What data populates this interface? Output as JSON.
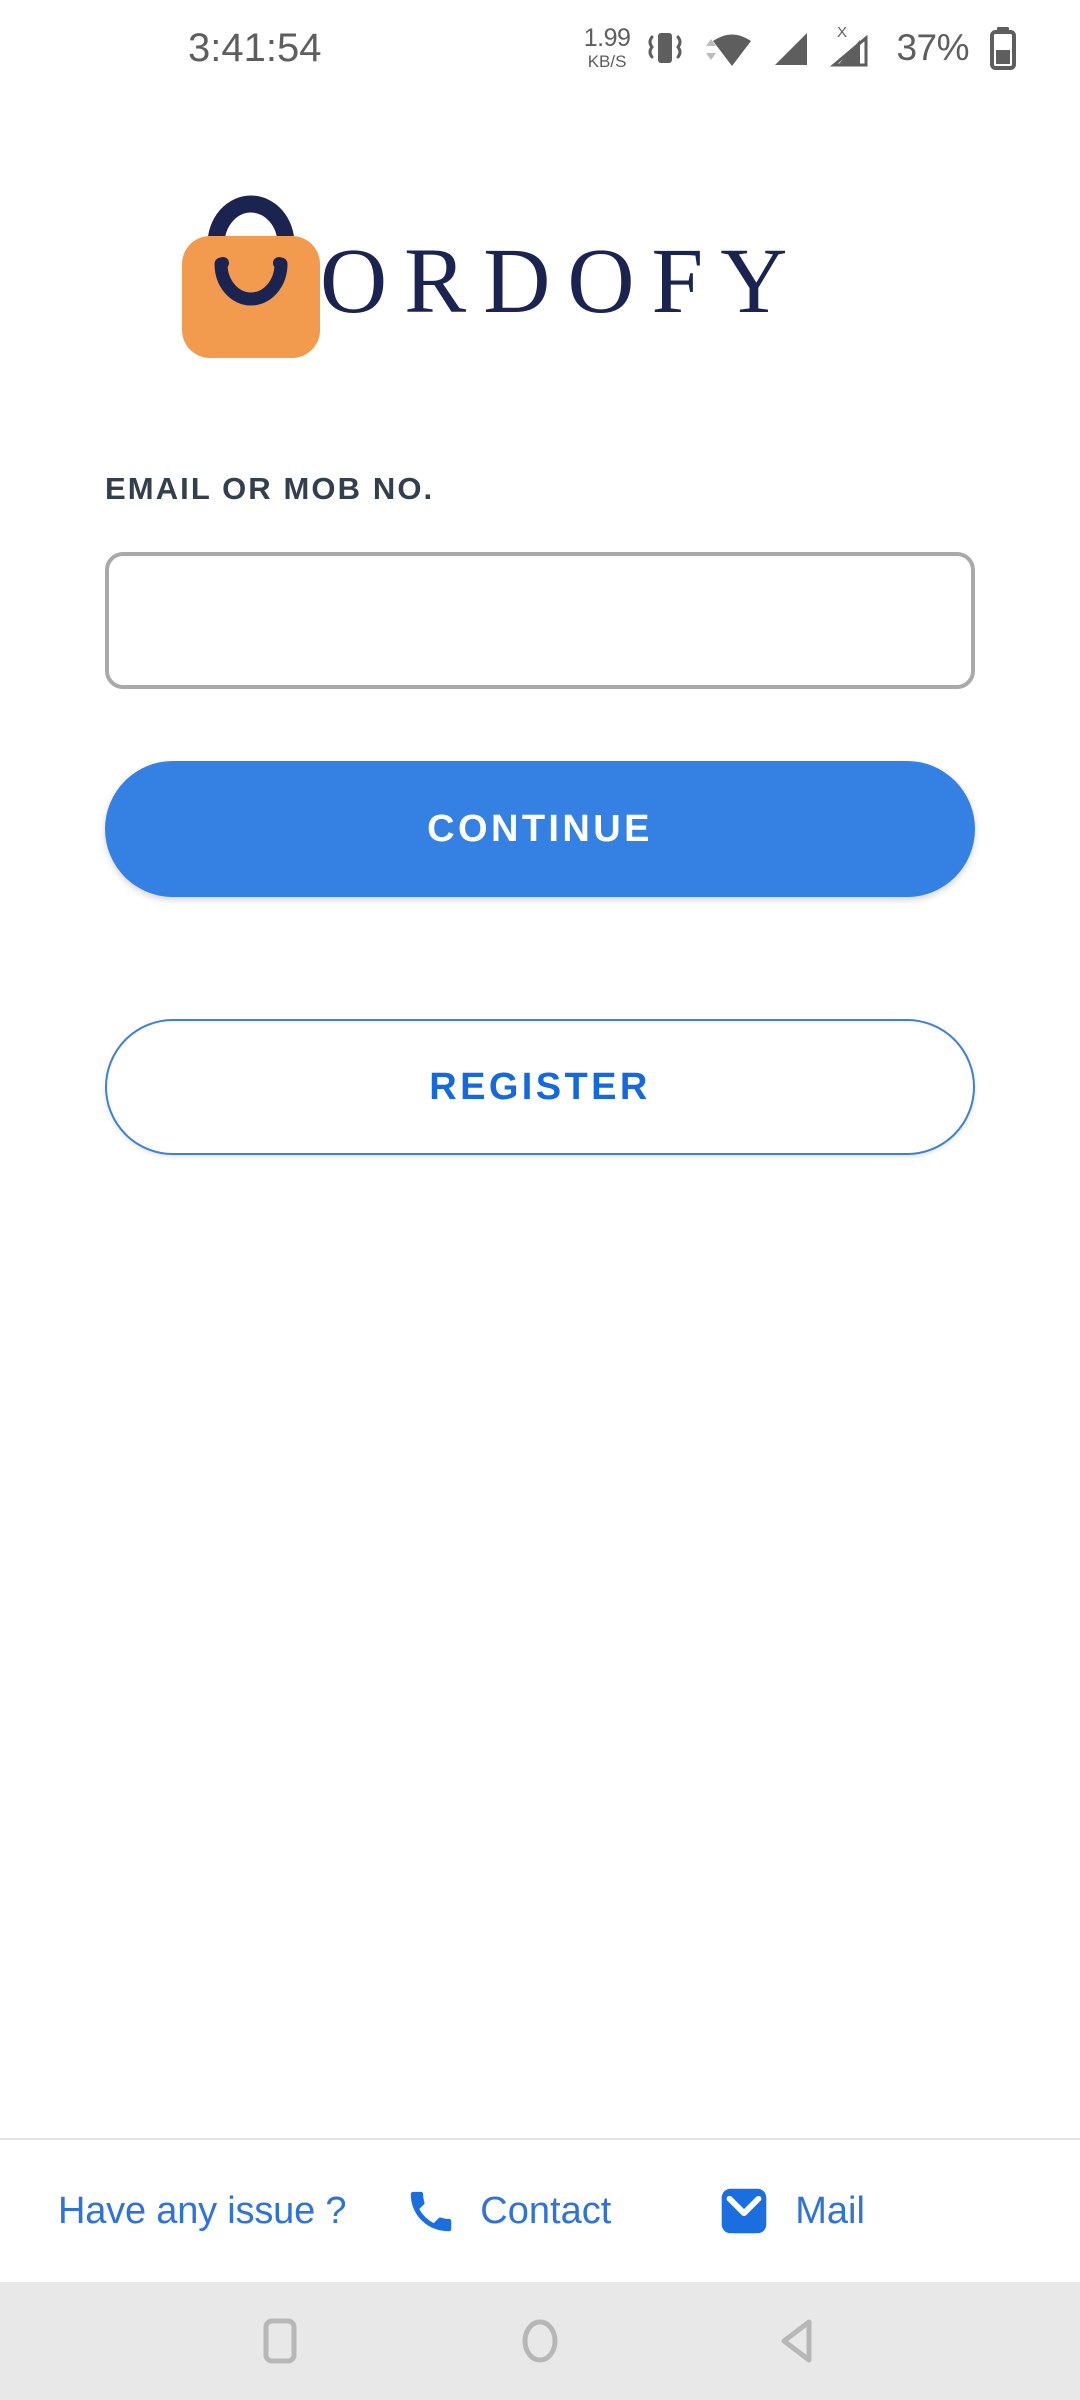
{
  "status_bar": {
    "time": "3:41:54",
    "network_speed_value": "1.99",
    "network_speed_unit": "KB/S",
    "icons": [
      "vibrate-icon",
      "wifi-icon",
      "signal-icon",
      "signal-no-service-icon"
    ],
    "battery_percent": "37%",
    "icon_color": "#5e5e5e"
  },
  "logo": {
    "brand_name": "ORDOFY",
    "bag_color": "#f29a4e",
    "brand_color": "#1b2350"
  },
  "form": {
    "field_label": "EMAIL OR MOB NO.",
    "input_value": "",
    "input_placeholder": "",
    "continue_label": "CONTINUE",
    "register_label": "REGISTER",
    "primary_color": "#3580e3",
    "outline_text_color": "#1669dc"
  },
  "footer": {
    "issue_text": "Have any issue ?",
    "contact_label": "Contact",
    "mail_label": "Mail",
    "link_color": "#2f73d8"
  },
  "navbar": {
    "recents_label": "Recents",
    "home_label": "Home",
    "back_label": "Back",
    "bg_color": "#e8e8e8",
    "icon_color": "#b7b7b7"
  }
}
